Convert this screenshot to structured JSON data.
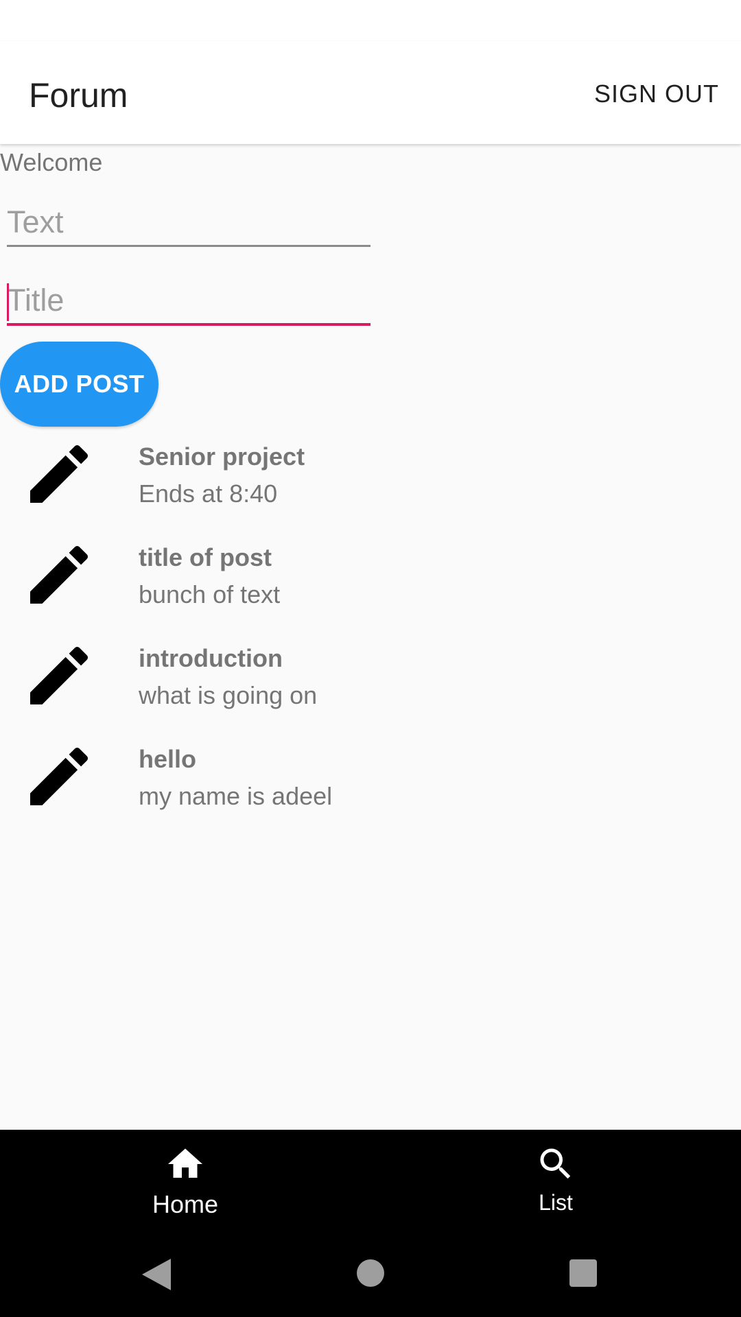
{
  "app_bar": {
    "title": "Forum",
    "sign_out_label": "SIGN OUT"
  },
  "welcome_text": "Welcome",
  "form": {
    "text_placeholder": "Text",
    "text_value": "",
    "title_placeholder": "Title",
    "title_value": "",
    "add_post_label": "ADD POST"
  },
  "posts": [
    {
      "title": "Senior project",
      "body": "Ends at 8:40",
      "icon": "pencil-icon"
    },
    {
      "title": "title of post",
      "body": "bunch of text",
      "icon": "pencil-icon"
    },
    {
      "title": "introduction",
      "body": "what is going on",
      "icon": "pencil-icon"
    },
    {
      "title": "hello",
      "body": "my name is adeel",
      "icon": "pencil-icon"
    }
  ],
  "bottom_nav": {
    "items": [
      {
        "label": "Home",
        "icon": "home-icon"
      },
      {
        "label": "List",
        "icon": "search-icon"
      }
    ]
  },
  "colors": {
    "accent": "#d81b60",
    "primary_button": "#2196f3",
    "nav_background": "#000000"
  }
}
